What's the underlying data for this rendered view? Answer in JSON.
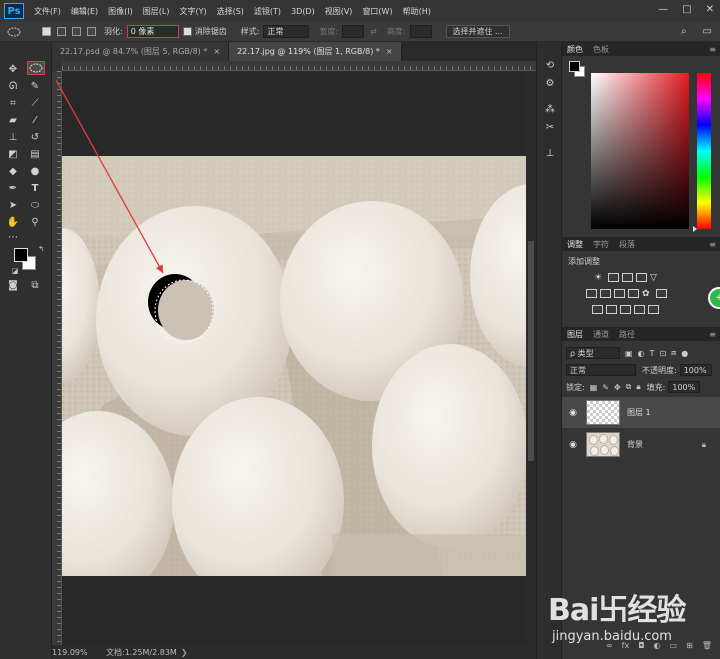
{
  "app": {
    "logo": "Ps"
  },
  "menu": [
    "文件(F)",
    "编辑(E)",
    "图像(I)",
    "图层(L)",
    "文字(Y)",
    "选择(S)",
    "滤镜(T)",
    "3D(D)",
    "视图(V)",
    "窗口(W)",
    "帮助(H)"
  ],
  "window_controls": {
    "minimize": "—",
    "maximize": "□",
    "close": "✕"
  },
  "options": {
    "feather_label": "羽化:",
    "feather_value": "0 像素",
    "antialias_label": "消除锯齿",
    "style_label": "样式:",
    "style_value": "正常",
    "width_label": "宽度:",
    "height_label": "高度:",
    "select_mask_label": "选择并遮住 ..."
  },
  "tabs": [
    {
      "label": "22.17.psd @ 84.7% (图层 5, RGB/8) *",
      "close": "×"
    },
    {
      "label": "22.17.jpg @ 119% (图层 1, RGB/8) *",
      "close": "×"
    }
  ],
  "status": {
    "zoom": "119.09%",
    "doc": "文档:1.25M/2.83M",
    "arrow": "❯"
  },
  "panels": {
    "color_tabs": [
      "颜色",
      "色板"
    ],
    "adjust_tabs": [
      "调整",
      "字符",
      "段落"
    ],
    "adjust_add": "添加调整",
    "layers_tabs": [
      "图层",
      "通道",
      "路径"
    ],
    "filter_kind": "ρ 类型",
    "blend_mode": "正常",
    "opacity_label": "不透明度:",
    "opacity_value": "100%",
    "lock_label": "锁定:",
    "fill_label": "填充:",
    "fill_value": "100%",
    "menu_glyph": "≡"
  },
  "layers": [
    {
      "name": "图层 1",
      "selected": true,
      "thumb": "transparent"
    },
    {
      "name": "背景",
      "selected": false,
      "thumb": "eggs",
      "locked": true
    }
  ],
  "badge": {
    "text": "+"
  },
  "watermark": {
    "logo": "Bai卐经验",
    "url": "jingyan.baidu.com"
  },
  "colors": {
    "accent_red": "#e04040",
    "fg": "#000000",
    "bg": "#ffffff",
    "badge": "#2eb84b"
  }
}
